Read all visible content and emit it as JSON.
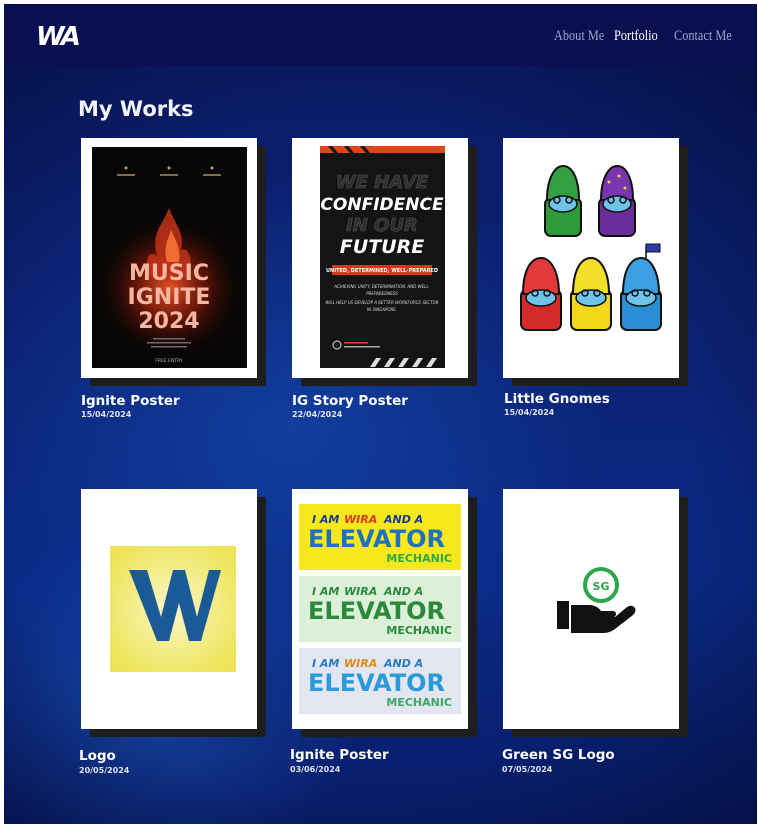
{
  "header": {
    "logo_text": "WA",
    "nav": [
      {
        "label": "About Me",
        "active": false
      },
      {
        "label": "Portfolio",
        "active": true
      },
      {
        "label": "Contact Me",
        "active": false
      }
    ]
  },
  "main": {
    "heading": "My Works",
    "works": [
      {
        "title": "Ignite Poster",
        "date": "15/04/2024",
        "thumbnail": {
          "lines": [
            "MUSIC",
            "IGNITE",
            "2024"
          ],
          "footer": "FREE ENTRY"
        }
      },
      {
        "title": "IG Story Poster",
        "date": "22/04/2024",
        "thumbnail": {
          "lines": [
            "WE HAVE",
            "CONFIDENCE",
            "IN OUR",
            "FUTURE"
          ],
          "banner": "UNITED, DETERMINED, WELL-PREPARED",
          "body": [
            "ACHIEVING UNITY, DETERMINATION, AND WELL-",
            "PREPAREDNESS",
            "WILL HELP US DEVELOP A BETTER WORKFORCE SECTOR",
            "IN SINGAPORE."
          ]
        }
      },
      {
        "title": "Little Gnomes",
        "date": "15/04/2024",
        "thumbnail": {}
      },
      {
        "title": "Logo",
        "date": "20/05/2024",
        "thumbnail": {}
      },
      {
        "title": "Ignite Poster",
        "date": "03/06/2024",
        "thumbnail": {
          "line1": "I AM",
          "line1_accent": "WIRA",
          "line1_end": "AND A",
          "line2": "ELEVATOR",
          "line3": "MECHANIC"
        }
      },
      {
        "title": "Green SG Logo",
        "date": "07/05/2024",
        "thumbnail": {
          "badge": "SG"
        }
      }
    ]
  },
  "colors": {
    "nav_bg": "#0a0f52",
    "page_bg": "#0b2376",
    "card_bg": "#ffffff",
    "card_shadow": "#1e1e1e",
    "nav_inactive": "#9aa6cc",
    "nav_active": "#ffffff"
  }
}
